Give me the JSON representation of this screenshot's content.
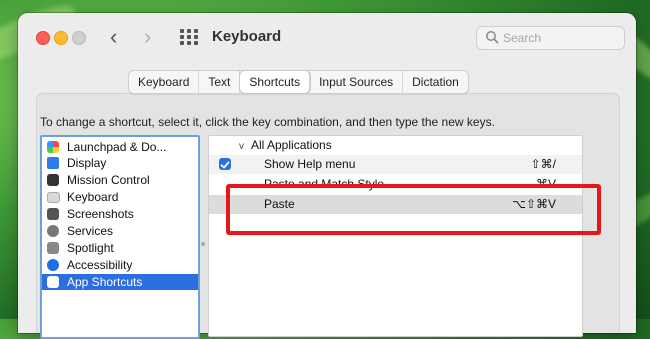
{
  "window": {
    "title": "Keyboard",
    "search_placeholder": "Search",
    "nav_back": "‹",
    "nav_forward": "›"
  },
  "tabs": [
    {
      "label": "Keyboard",
      "active": false
    },
    {
      "label": "Text",
      "active": false
    },
    {
      "label": "Shortcuts",
      "active": true
    },
    {
      "label": "Input Sources",
      "active": false
    },
    {
      "label": "Dictation",
      "active": false
    }
  ],
  "instructions": "To change a shortcut, select it, click the key combination, and then type the new keys.",
  "categories": [
    {
      "label": "Launchpad & Do...",
      "icon": "launchpad-icon",
      "selected": false
    },
    {
      "label": "Display",
      "icon": "display-icon",
      "selected": false
    },
    {
      "label": "Mission Control",
      "icon": "mission-control-icon",
      "selected": false
    },
    {
      "label": "Keyboard",
      "icon": "keyboard-icon",
      "selected": false
    },
    {
      "label": "Screenshots",
      "icon": "screenshots-icon",
      "selected": false
    },
    {
      "label": "Services",
      "icon": "services-icon",
      "selected": false
    },
    {
      "label": "Spotlight",
      "icon": "spotlight-icon",
      "selected": false
    },
    {
      "label": "Accessibility",
      "icon": "accessibility-icon",
      "selected": false
    },
    {
      "label": "App Shortcuts",
      "icon": "app-shortcuts-icon",
      "selected": true
    }
  ],
  "shortcuts": {
    "group_label": "All Applications",
    "group_chevron": "v",
    "rows": [
      {
        "name": "Show Help menu",
        "keys": "⇧⌘/",
        "checked": true
      },
      {
        "name": "Paste and Match Style",
        "keys": "⌘V",
        "checked": false
      },
      {
        "name": "Paste",
        "keys": "⌥⇧⌘V",
        "checked": false
      }
    ]
  },
  "colors": {
    "selection": "#2a6fe0",
    "highlight_box": "#e4171b",
    "close": "#fe5f57",
    "minimize": "#febc2e"
  }
}
